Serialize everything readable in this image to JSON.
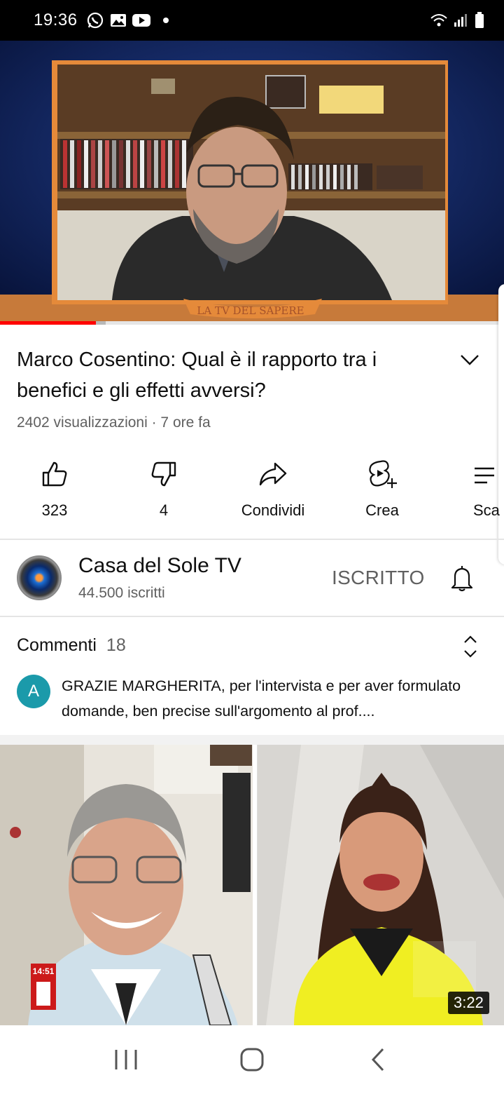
{
  "status_bar": {
    "time": "19:36",
    "notification_icons": [
      "whatsapp-icon",
      "gallery-icon",
      "youtube-icon"
    ],
    "system_icons": [
      "wifi-icon",
      "signal-icon",
      "battery-icon"
    ]
  },
  "player": {
    "overlay_text": "LA TV DEL SAPERE",
    "progress_played": 0.19,
    "progress_buffered": 0.21
  },
  "video": {
    "title": "Marco Cosentino: Qual è il rapporto tra i benefici e gli effetti avversi?",
    "meta": "2402 visualizzazioni · 7 ore fa"
  },
  "actions": {
    "like": "323",
    "dislike": "4",
    "share": "Condividi",
    "create": "Crea",
    "save_partial": "Sca"
  },
  "channel": {
    "name": "Casa del Sole TV",
    "subscribers": "44.500 iscritti",
    "subscribed_label": "ISCRITTO"
  },
  "comments": {
    "title": "Commenti",
    "count": "18",
    "first_avatar": "A",
    "first_text": "GRAZIE MARGHERITA, per l'intervista e per aver formulato domande, ben precise sull'argomento al prof...."
  },
  "next_video": {
    "thumb_time": "14:51",
    "duration": "3:22"
  },
  "colors": {
    "accent": "#ff0000",
    "player_bg": "#0b1a4a",
    "comment_avatar": "#1b9aaa"
  }
}
